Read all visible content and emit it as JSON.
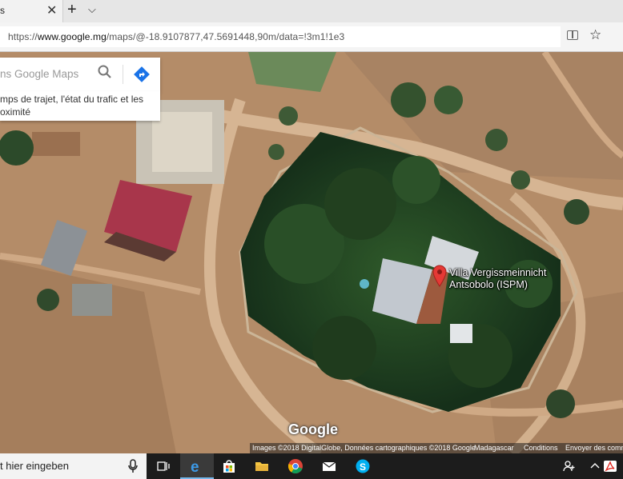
{
  "browser": {
    "tab_title": "s",
    "url_prefix": "https://",
    "url_host": "www.google.mg",
    "url_path": "/maps/@-18.9107877,47.5691448,90m/data=!3m1!1e3"
  },
  "search": {
    "placeholder": "ns Google Maps",
    "info_line1": "mps de trajet, l'état du trafic et les",
    "info_line2": "oximité"
  },
  "place": {
    "name_line1": "Villa Vergissmeinnicht",
    "name_line2": "Antsobolo (ISPM)",
    "pin_color": "#e53935"
  },
  "map_footer": {
    "logo": "Google",
    "imagery": "Images ©2018 DigitalGlobe, Données cartographiques ©2018 Google",
    "country": "Madagascar",
    "conditions": "Conditions",
    "feedback": "Envoyer des comm"
  },
  "taskbar": {
    "search_text": "t hier eingeben",
    "icons": [
      "task-view",
      "edge",
      "store",
      "file-explorer",
      "chrome",
      "mail",
      "skype"
    ],
    "tray_icons": [
      "people",
      "chevron-up",
      "acrobat"
    ]
  }
}
